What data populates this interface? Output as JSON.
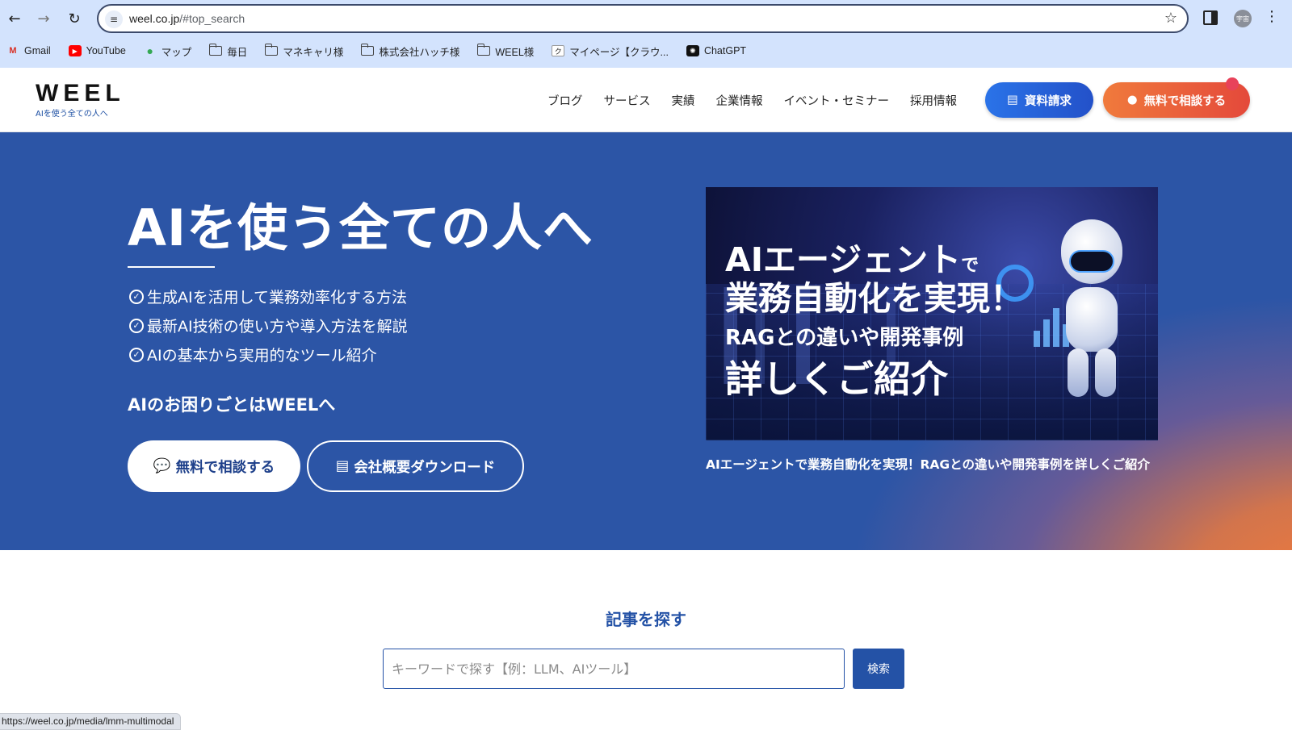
{
  "browser": {
    "url_host": "weel.co.jp",
    "url_path": "/#top_search",
    "avatar_label": "宇宙",
    "bookmarks": [
      {
        "label": "Gmail",
        "icon": "gmail-icon"
      },
      {
        "label": "YouTube",
        "icon": "youtube-icon"
      },
      {
        "label": "マップ",
        "icon": "maps-icon"
      },
      {
        "label": "毎日",
        "icon": "folder-icon"
      },
      {
        "label": "マネキャリ様",
        "icon": "folder-icon"
      },
      {
        "label": "株式会社ハッチ様",
        "icon": "folder-icon"
      },
      {
        "label": "WEEL様",
        "icon": "folder-icon"
      },
      {
        "label": "マイページ【クラウ...",
        "icon": "crowdworks-icon"
      },
      {
        "label": "ChatGPT",
        "icon": "chatgpt-icon"
      }
    ],
    "status_url": "https://weel.co.jp/media/lmm-multimodal"
  },
  "header": {
    "logo_mark": "WEEL",
    "logo_tagline": "AIを使う全ての人へ",
    "nav": [
      "ブログ",
      "サービス",
      "実績",
      "企業情報",
      "イベント・セミナー",
      "採用情報"
    ],
    "doc_button": "資料請求",
    "consult_button": "無料で相談する"
  },
  "hero": {
    "title": "AIを使う全ての人へ",
    "features": [
      "生成AIを活用して業務効率化する方法",
      "最新AI技術の使い方や導入方法を解説",
      "AIの基本から実用的なツール紹介"
    ],
    "subtitle": "AIのお困りごとはWEELへ",
    "cta_consult": "無料で相談する",
    "cta_download": "会社概要ダウンロード",
    "banner": {
      "line1_main": "AIエージェント",
      "line1_small": "で",
      "line2": "業務自動化を実現！",
      "line3": "RAGとの違いや開発事例",
      "line4": "詳しくご紹介"
    },
    "banner_caption": "AIエージェントで業務自動化を実現！RAGとの違いや開発事例を詳しくご紹介"
  },
  "search": {
    "title": "記事を探す",
    "placeholder": "キーワードで探す【例：LLM、AIツール】",
    "button": "検索"
  },
  "colors": {
    "brand_blue": "#2c55a6",
    "accent_orange": "#f07a3c",
    "chrome_bg": "#d3e3fd"
  }
}
